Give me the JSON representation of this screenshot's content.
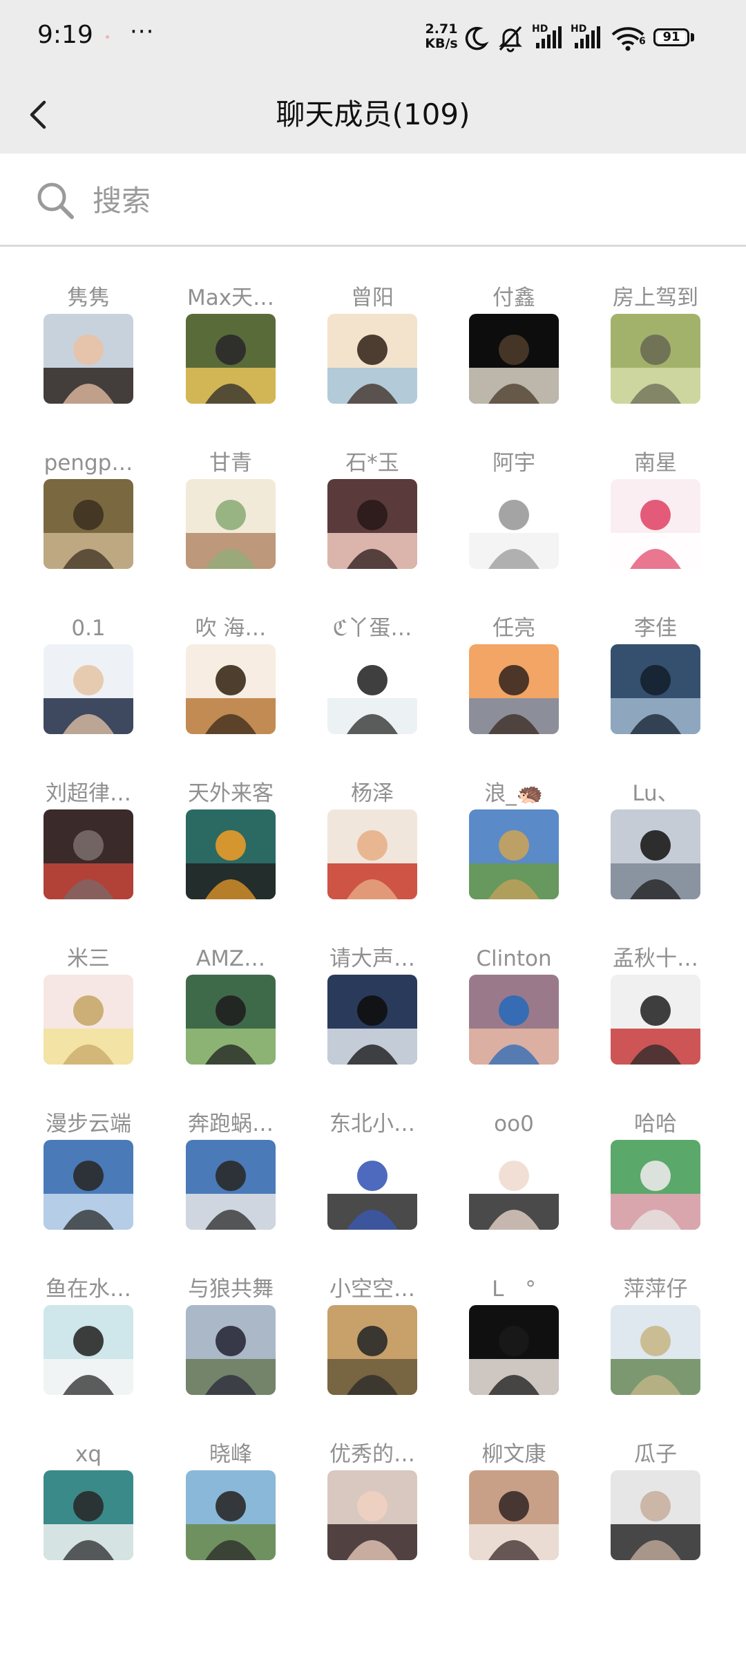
{
  "status_bar": {
    "time": "9:19",
    "more": "···",
    "net_speed_value": "2.71",
    "net_speed_unit": "KB/s",
    "signal_1_label": "HD",
    "signal_2_label": "HD",
    "wifi_label": "6",
    "battery": "91",
    "icons": [
      "moon-icon",
      "mute-icon",
      "signal-icon",
      "signal-icon",
      "wifi-icon",
      "battery-icon"
    ]
  },
  "header": {
    "title": "聊天成员(109)",
    "back_icon": "chevron-left-icon"
  },
  "search": {
    "placeholder": "搜索",
    "value": "",
    "icon": "search-icon"
  },
  "members": [
    {
      "name": "隽隽"
    },
    {
      "name": "Max天…"
    },
    {
      "name": "曾阳"
    },
    {
      "name": "付鑫"
    },
    {
      "name": "房上驾到"
    },
    {
      "name": "pengp…"
    },
    {
      "name": "甘青"
    },
    {
      "name": "石*玉"
    },
    {
      "name": "阿宇"
    },
    {
      "name": "南星"
    },
    {
      "name": "0.1"
    },
    {
      "name": "吹 海…"
    },
    {
      "name": "ℭ丫蛋…"
    },
    {
      "name": "任亮"
    },
    {
      "name": "李佳"
    },
    {
      "name": "刘超律…"
    },
    {
      "name": "天外来客"
    },
    {
      "name": "杨泽"
    },
    {
      "name": "浪_🦔"
    },
    {
      "name": "Lu、"
    },
    {
      "name": "米三"
    },
    {
      "name": "AMZ…"
    },
    {
      "name": "请大声…"
    },
    {
      "name": "Clinton"
    },
    {
      "name": "孟秋十…"
    },
    {
      "name": "漫步云端"
    },
    {
      "name": "奔跑蜗…"
    },
    {
      "name": "东北小…"
    },
    {
      "name": "oo0"
    },
    {
      "name": "哈哈"
    },
    {
      "name": "鱼在水…"
    },
    {
      "name": "与狼共舞"
    },
    {
      "name": "小空空…"
    },
    {
      "name": "L　°"
    },
    {
      "name": "萍萍仔"
    },
    {
      "name": "xq"
    },
    {
      "name": "晓峰"
    },
    {
      "name": "优秀的…"
    },
    {
      "name": "柳文康"
    },
    {
      "name": "瓜子"
    },
    {
      "name": ""
    },
    {
      "name": ""
    },
    {
      "name": ""
    },
    {
      "name": ""
    },
    {
      "name": ""
    }
  ],
  "avatar_colors": [
    [
      "#8aa1b8",
      "#e6dccd",
      "#5b4b3f"
    ],
    [
      "#f2f2f2",
      "#d9d9d9",
      "#5a5a5a"
    ],
    [
      "#f1a7a0",
      "#f6c6bd",
      "#e48a86"
    ],
    [
      "#7b5a3a",
      "#b88e64",
      "#4a3a2a"
    ],
    [
      "#f5e6c8",
      "#e6a445",
      "#c03030"
    ],
    [
      "#c8d2dd",
      "#2b2420",
      "#e9c1a5"
    ],
    [
      "#5a6b3a",
      "#e8c25a",
      "#2a2a2a"
    ],
    [
      "#f3e3cc",
      "#a7c6d9",
      "#3b2a20"
    ],
    [
      "#0d0d0d",
      "#dcd5c8",
      "#4a3a2a"
    ],
    [
      "#a3b26a",
      "#d5dca8",
      "#6b6b55"
    ],
    [
      "#7a6840",
      "#c9b48e",
      "#3e3220"
    ],
    [
      "#f2ead8",
      "#b5896a",
      "#8fae7a"
    ],
    [
      "#5a3a3a",
      "#f2cbbf",
      "#2a1a1a"
    ],
    [
      "#ffffff",
      "#f2f2f2",
      "#9a9a9a"
    ],
    [
      "#fbeef2",
      "#ffffff",
      "#e04a6a"
    ],
    [
      "#eef2f6",
      "#1e2a44",
      "#e6c6a8"
    ],
    [
      "#f7ede2",
      "#b8793a",
      "#3a2a1a"
    ],
    [
      "#ffffff",
      "#e9eef2",
      "#2a2a2a"
    ],
    [
      "#f2a564",
      "#7a8ba3",
      "#3b2a20"
    ],
    [
      "#34506e",
      "#9fb6cc",
      "#14202e"
    ],
    [
      "#3a2a2a",
      "#c8453a",
      "#7a6a6a"
    ],
    [
      "#2b6a62",
      "#222222",
      "#e89a2a"
    ],
    [
      "#f0e6dc",
      "#c83a2a",
      "#e8b08a"
    ],
    [
      "#5a8ac8",
      "#6a9a4a",
      "#c8a25a"
    ],
    [
      "#c5ccd6",
      "#7f8a96",
      "#1c1c1c"
    ],
    [
      "#f6e7e4",
      "#f2e29a",
      "#c8a86a"
    ],
    [
      "#3f6a4a",
      "#9abf7a",
      "#202020"
    ],
    [
      "#2a3a5a",
      "#dfe6ee",
      "#101010"
    ],
    [
      "#9a7a8a",
      "#e6b8a6",
      "#2a6ab8"
    ],
    [
      "#f0f0f0",
      "#c83a3a",
      "#2a2a2a"
    ],
    [
      "#4a7ab8",
      "#c8dcef",
      "#2a2a2a"
    ],
    [
      "#4a7ab8",
      "#e6e6e6",
      "#2a2a2a"
    ],
    [
      "#ffffff",
      "#2a2a2a",
      "#3a5ab8"
    ],
    [
      "#ffffff",
      "#2a2a2a",
      "#f0dcd0"
    ],
    [
      "#5aa86a",
      "#f0a6b8",
      "#e8e8e8"
    ],
    [
      "#cfe6ea",
      "#f6f6f6",
      "#2a2a2a"
    ],
    [
      "#aab8c8",
      "#6a7a5a",
      "#2a2a3a"
    ],
    [
      "#c8a06a",
      "#6a5a3a",
      "#2a2a2a"
    ],
    [
      "#101010",
      "#f0e6e0",
      "#1a1a1a"
    ],
    [
      "#dfe8ef",
      "#6a8a5a",
      "#c8b88a"
    ],
    [
      "#3a8a8a",
      "#f2f2f2",
      "#2a2a2a"
    ],
    [
      "#8ab8d8",
      "#6a8a4a",
      "#2a2a2a"
    ],
    [
      "#d8c8c0",
      "#3a2a2a",
      "#f0d0c0"
    ],
    [
      "#c8a088",
      "#f0e6e0",
      "#3a2a2a"
    ],
    [
      "#e6e6e6",
      "#2a2a2a",
      "#c8b0a0"
    ]
  ]
}
